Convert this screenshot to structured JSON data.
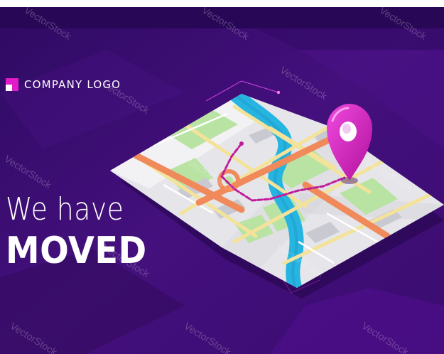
{
  "logo": {
    "text": "COMPANY LOGO",
    "mark_color": "#e21cc8"
  },
  "headline": {
    "line1": "We have",
    "line2": "MOVED"
  },
  "watermark": {
    "text": "VectorStock"
  },
  "colors": {
    "background": "#3a0a6e",
    "accent_magenta": "#e21cc8",
    "map_paper": "#e6e6ea",
    "river": "#26b4e0",
    "park": "#b9e3a3",
    "main_road": "#f08a5b",
    "secondary_road": "#f3e39a",
    "route": "#c01a9a"
  }
}
